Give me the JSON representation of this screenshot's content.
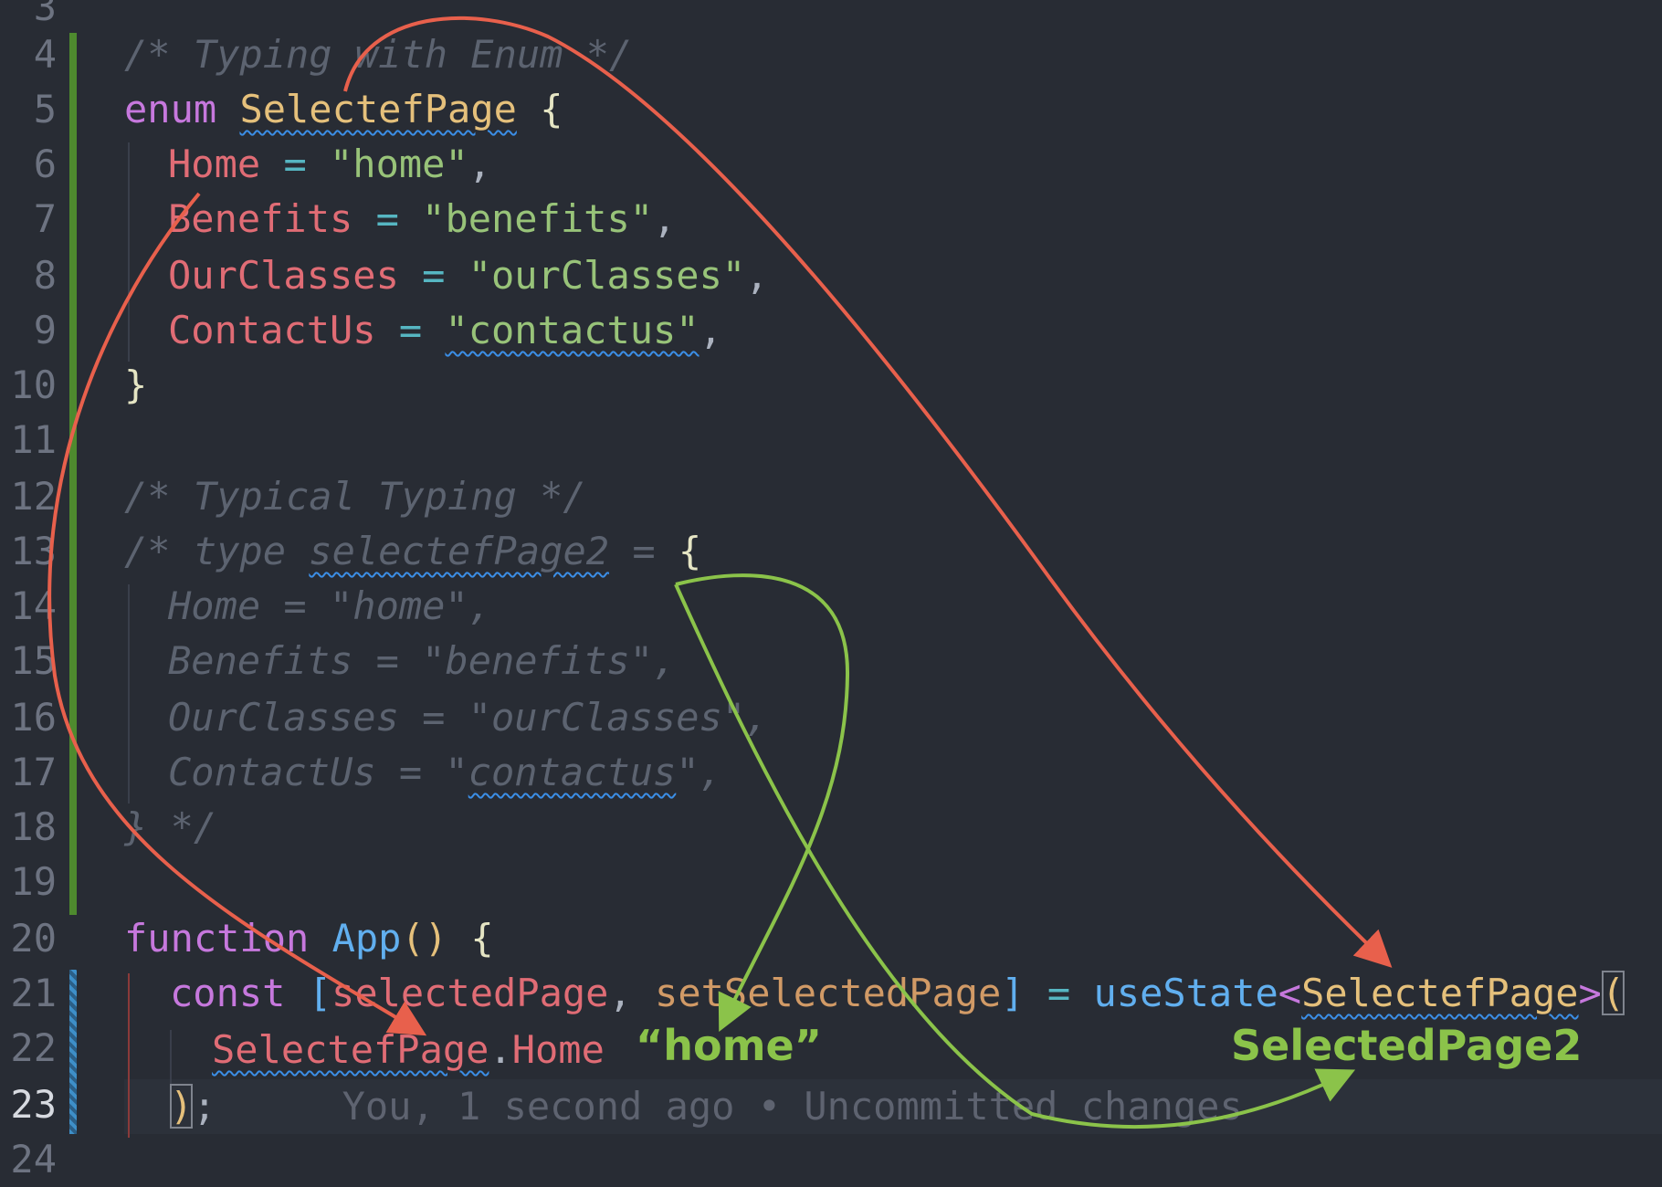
{
  "gutter": [
    "3",
    "4",
    "5",
    "6",
    "7",
    "8",
    "9",
    "10",
    "11",
    "12",
    "13",
    "14",
    "15",
    "16",
    "17",
    "18",
    "19",
    "20",
    "21",
    "22",
    "23",
    "24"
  ],
  "active_line": "23",
  "code": {
    "l4_comment": "/* Typing with Enum */",
    "l5_enum_kw": "enum",
    "l5_enum_name": "SelectefPage",
    "l5_brace": "{",
    "l6_key": "Home",
    "l6_val": "\"home\"",
    "l7_key": "Benefits",
    "l7_val": "\"benefits\"",
    "l8_key": "OurClasses",
    "l8_val": "\"ourClasses\"",
    "l9_key": "ContactUs",
    "l9_val": "\"contactus\"",
    "l10_brace": "}",
    "l12_comment": "/* Typical Typing */",
    "l13_a": "/* type ",
    "l13_name": "selectefPage2",
    "l13_b": " = ",
    "l13_brace": "{",
    "l14": "Home = \"home\",",
    "l15": "Benefits = \"benefits\",",
    "l16": "OurClasses = \"ourClasses\",",
    "l17_a": "ContactUs = \"",
    "l17_sq": "contactus",
    "l17_b": "\",",
    "l18": "} */",
    "l20_kw": "function",
    "l20_fn": "App",
    "l20_paren": "()",
    "l20_brace": "{",
    "l21_kw": "const",
    "l21_open": "[",
    "l21_var1": "selectedPage",
    "l21_comma": ", ",
    "l21_var2": "setSelectedPage",
    "l21_close": "]",
    "l21_eq": " = ",
    "l21_fn": "useState",
    "l21_lt": "<",
    "l21_type": "SelectefPage",
    "l21_gt": ">",
    "l21_paren": "(",
    "l22_type": "SelectefPage",
    "l22_dot": ".",
    "l22_prop": "Home",
    "l23_paren": ")",
    "l23_semi": ";",
    "l23_blame": "You, 1 second ago • Uncommitted changes",
    "eq": " = ",
    "comma": ","
  },
  "annotations": {
    "home_text": "“home”",
    "selected_page2_text": "SelectedPage2"
  },
  "colors": {
    "background": "#282c34",
    "red_arrow": "#e8604c",
    "green_arrow": "#8bc34a"
  }
}
